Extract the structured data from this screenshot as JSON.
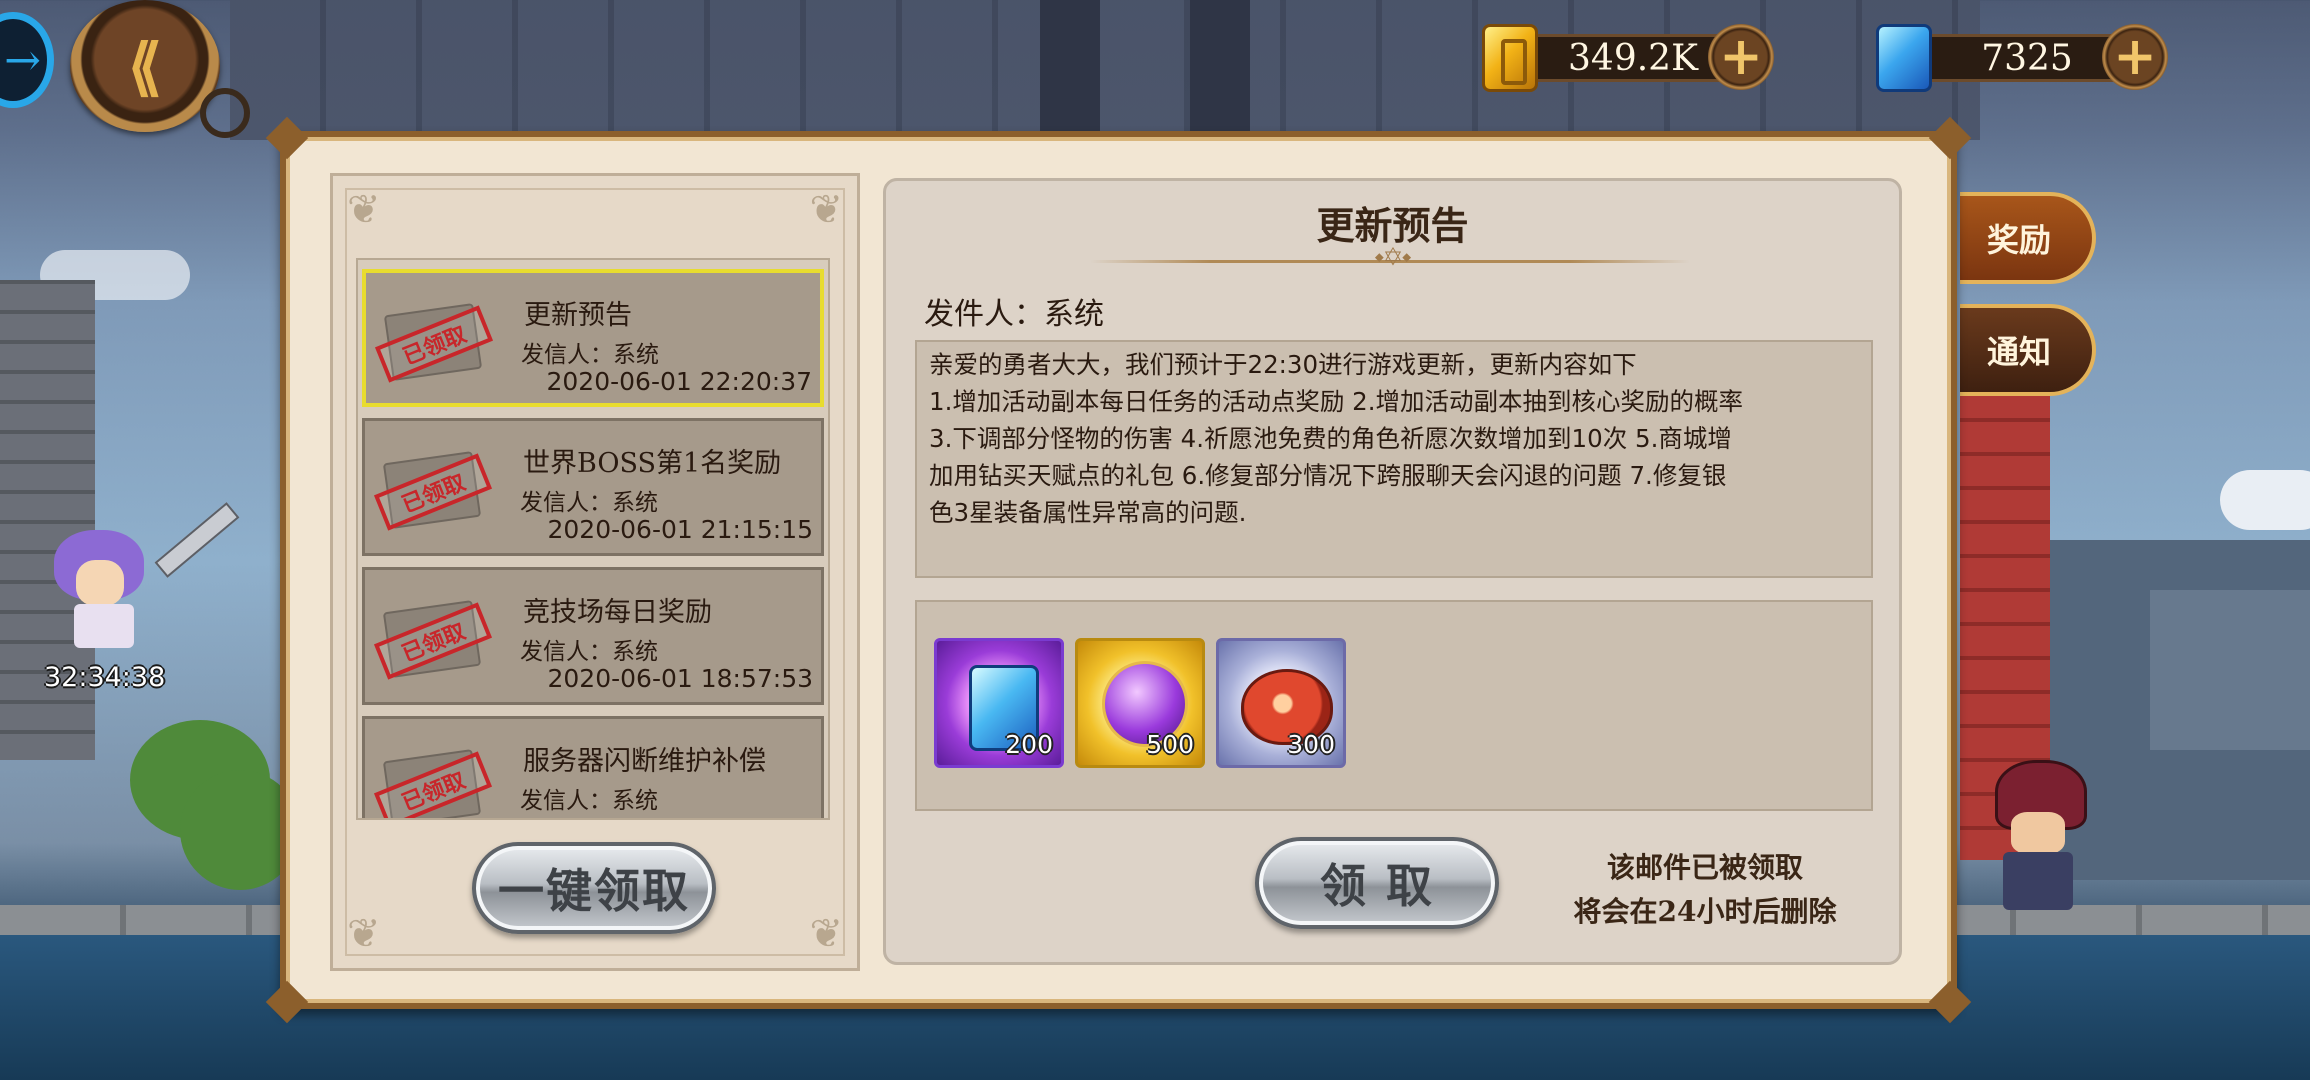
{
  "hud": {
    "gold_amount": "349.2K",
    "gem_amount": "7325",
    "add_symbol": "+",
    "back_symbol": "⟪",
    "exit_symbol": "→",
    "timer": "32:34:38"
  },
  "mail_list": [
    {
      "title": "更新预告",
      "sender": "发信人：系统",
      "time": "2020-06-01 22:20:37",
      "stamp": "已领取",
      "selected": true
    },
    {
      "title": "世界BOSS第1名奖励",
      "sender": "发信人：系统",
      "time": "2020-06-01 21:15:15",
      "stamp": "已领取",
      "selected": false
    },
    {
      "title": "竞技场每日奖励",
      "sender": "发信人：系统",
      "time": "2020-06-01 18:57:53",
      "stamp": "已领取",
      "selected": false
    },
    {
      "title": "服务器闪断维护补偿",
      "sender": "发信人：系统",
      "time": "",
      "stamp": "已领取",
      "selected": false
    }
  ],
  "claim_all_label": "一键领取",
  "detail": {
    "title": "更新预告",
    "title_ornament": "⬩✡⬩",
    "sender_line": "发件人：系统",
    "content": "亲爱的勇者大大，我们预计于22:30进行游戏更新，更新内容如下\n1.增加活动副本每日任务的活动点奖励 2.增加活动副本抽到核心奖励的概率\n3.下调部分怪物的伤害  4.祈愿池免费的角色祈愿次数增加到10次 5.商城增\n加用钻买天赋点的礼包 6.修复部分情况下跨服聊天会闪退的问题 7.修复银\n色3星装备属性异常高的问题.",
    "rewards": [
      {
        "icon": "gem-card-icon",
        "count": "200"
      },
      {
        "icon": "purple-orb-icon",
        "count": "500"
      },
      {
        "icon": "meat-icon",
        "count": "300"
      }
    ],
    "claim_label": "领 取",
    "claimed_note_1": "该邮件已被领取",
    "claimed_note_2": "将会在24小时后删除"
  },
  "side_tabs": {
    "reward_label": "奖励",
    "notice_label": "通知"
  },
  "colors": {
    "panel_bg": "#f2e6d3",
    "frame_brown": "#8c5f2c",
    "selected_border": "#e8dc2e",
    "stamp_red": "#c8262a",
    "tab_orange": "#a8561a"
  }
}
